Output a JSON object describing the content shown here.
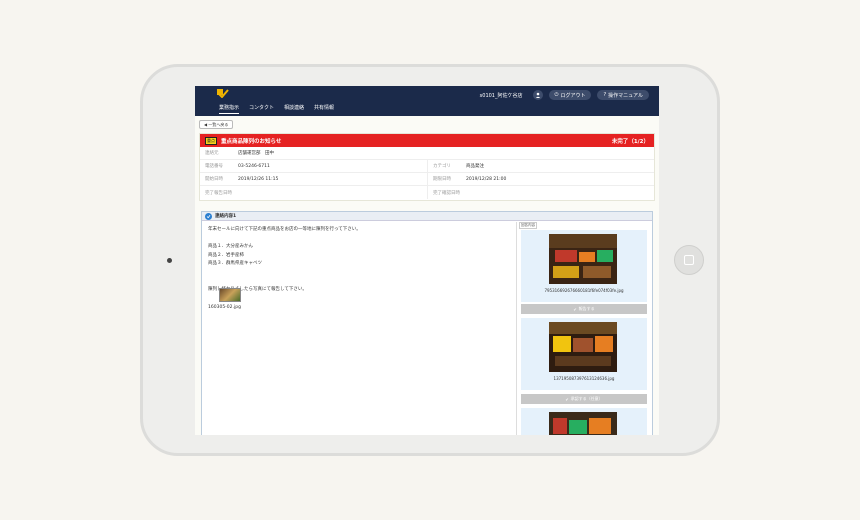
{
  "header": {
    "nav": [
      "業務指示",
      "コンタクト",
      "相談連絡",
      "共有情報"
    ],
    "store": "s0101_阿佐ケ谷店",
    "logout": "ログアウト",
    "manual": "操作マニュアル"
  },
  "back_label": "一覧へ戻る",
  "notice": {
    "icon_text": "重点",
    "title": "重点商品陳列のお知らせ",
    "status": "未完了（1/2）",
    "rows": [
      {
        "label": "連絡元",
        "value": "店舗運営部　田中"
      },
      {
        "label": "電話番号",
        "value": "03-5246-6711",
        "label2": "カテゴリ",
        "value2": "商品発注"
      },
      {
        "label": "開始日時",
        "value": "2019/12/26 11:15",
        "label2": "期限日時",
        "value2": "2019/12/28 21:00"
      },
      {
        "label": "完了報告日時",
        "value": "",
        "label2": "完了確認日時",
        "value2": ""
      }
    ]
  },
  "detail": {
    "title": "連絡内容1",
    "lines": [
      "年末セールに向けて下記の重点商品をお店の一等地に陳列を行って下さい。",
      "",
      "商品１．大分産みかん",
      "商品２．岩手産柿",
      "商品３．群馬県産キャベツ",
      "",
      "",
      "陳列し終わりましたら写真にて報告して下さい。"
    ],
    "attachment": "160305-02.jpg",
    "report_label": "回答内容",
    "photos": [
      {
        "name": "795316692676660181f6fe074f03fe.jpg",
        "button": "報告する"
      },
      {
        "name": "137195087397613124636.jpg",
        "button": "承認する（任意）"
      }
    ]
  }
}
